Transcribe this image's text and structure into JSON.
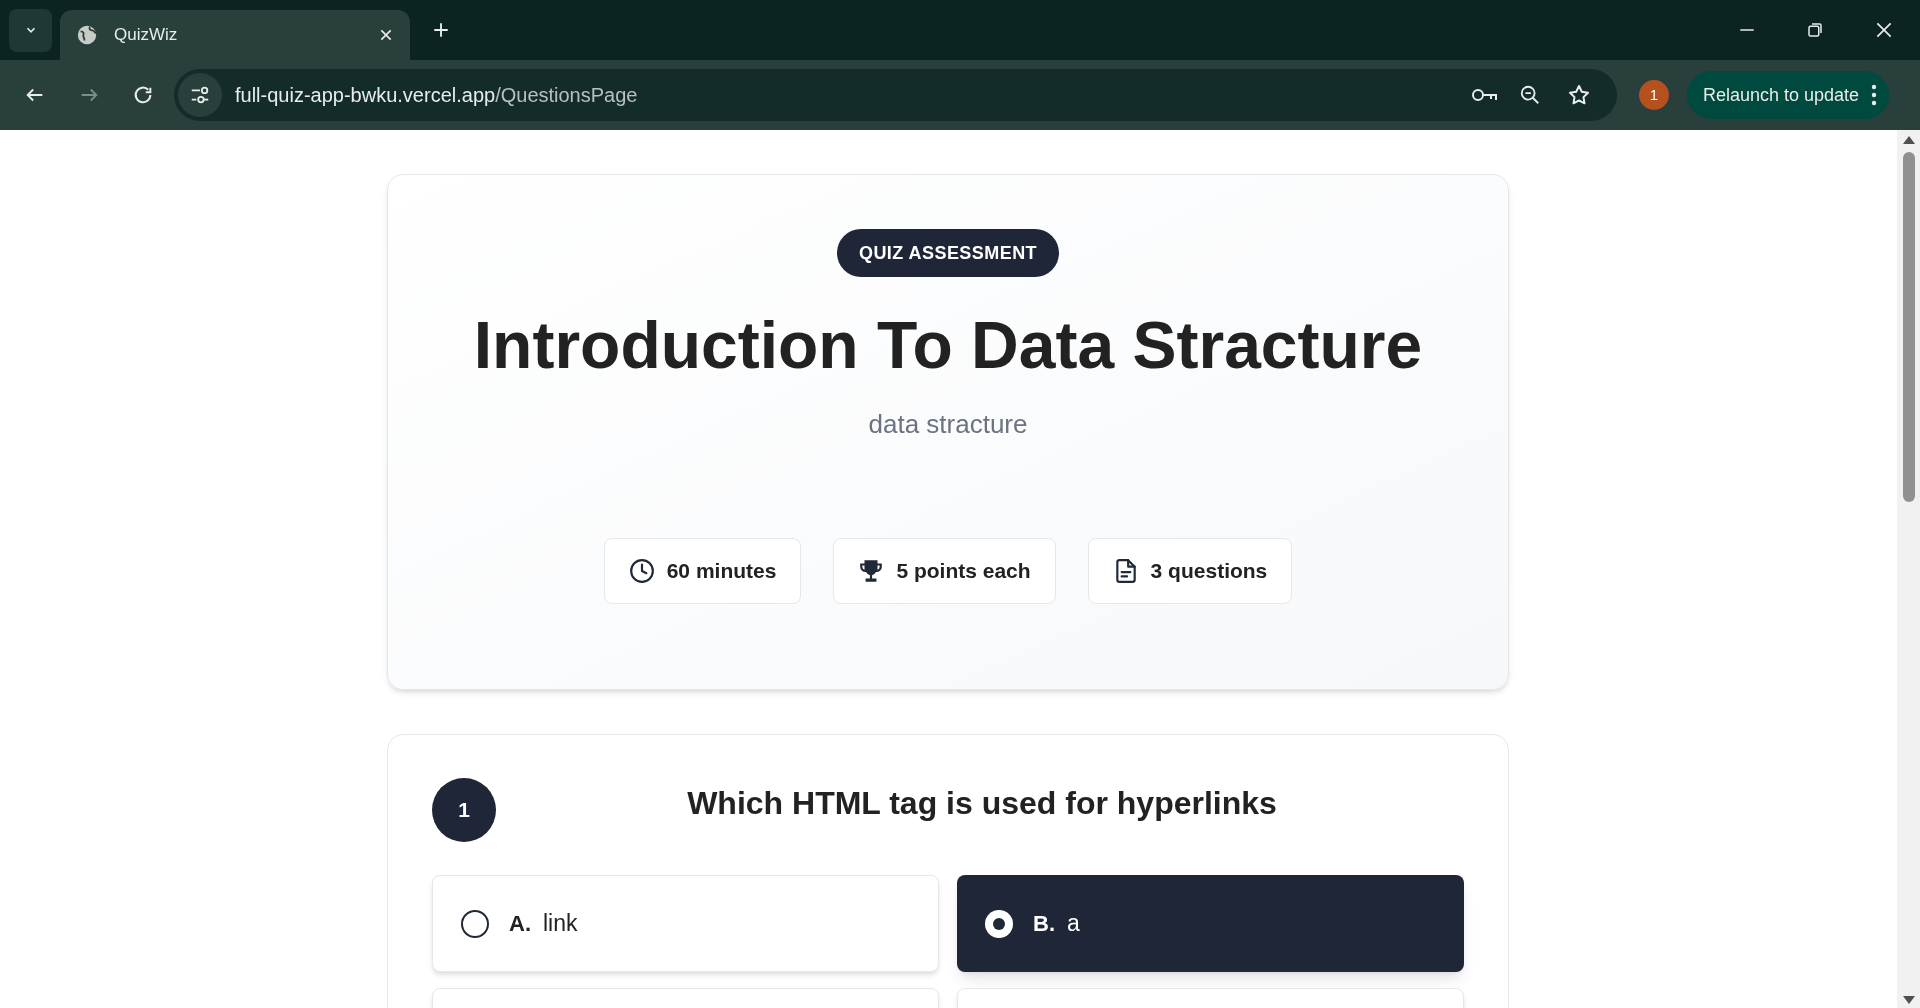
{
  "browser": {
    "tab_title": "QuizWiz",
    "url_host": "full-quiz-app-bwku.vercel.app",
    "url_path": "/QuestionsPage",
    "profile_badge": "1",
    "update_button": "Relaunch to update"
  },
  "header": {
    "badge": "QUIZ ASSESSMENT",
    "title": "Introduction To Data Stracture",
    "subtitle": "data stracture",
    "stats": [
      {
        "kind": "time",
        "label": "60 minutes"
      },
      {
        "kind": "points",
        "label": "5 points each"
      },
      {
        "kind": "questions",
        "label": "3 questions"
      }
    ]
  },
  "question": {
    "number": "1",
    "text": "Which HTML tag is used for hyperlinks",
    "options": [
      {
        "letter": "A.",
        "text": "link",
        "selected": false
      },
      {
        "letter": "B.",
        "text": "a",
        "selected": true
      }
    ]
  }
}
